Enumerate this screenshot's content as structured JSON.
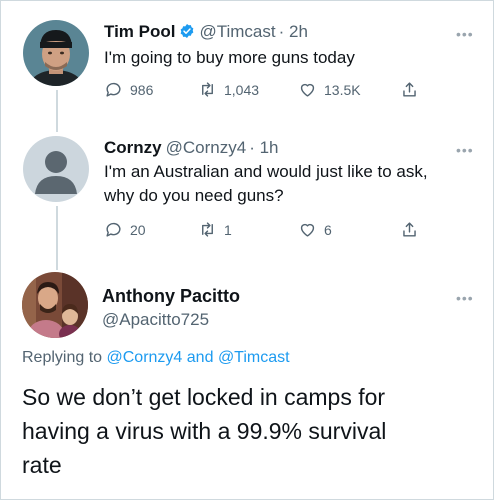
{
  "tweets": [
    {
      "name": "Tim Pool",
      "handle": "@Timcast",
      "time": "· 2h",
      "text": "I'm going to buy more guns today",
      "replies": "986",
      "retweets": "1,043",
      "likes": "13.5K",
      "verified": true
    },
    {
      "name": "Cornzy",
      "handle": "@Cornzy4",
      "time": "· 1h",
      "text_line1": "I'm an Australian and would just like to ask,",
      "text_line2": "why do you need guns?",
      "replies": "20",
      "retweets": "1",
      "likes": "6"
    }
  ],
  "focused": {
    "name": "Anthony Pacitto",
    "handle": "@Apacitto725",
    "replying_prefix": "Replying to",
    "mention1": "@Cornzy4",
    "and": "and",
    "mention2": "@Timcast",
    "text_line1": "So we don’t get locked in camps for",
    "text_line2": "having a virus with a 99.9% survival",
    "text_line3": "rate"
  },
  "more_icon": "•••",
  "colors": {
    "accent": "#1d9bf0",
    "secondary_text": "#536471",
    "thread_line": "#cfd9de"
  }
}
